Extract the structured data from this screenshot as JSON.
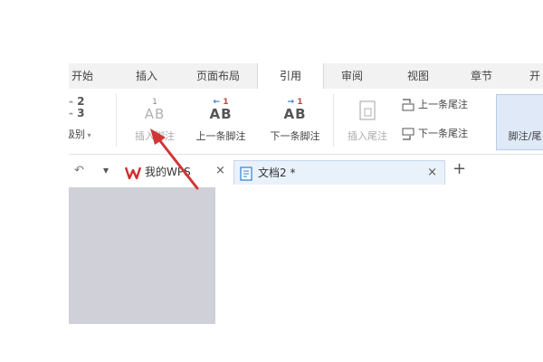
{
  "menu": {
    "tabs": [
      {
        "label": "开始"
      },
      {
        "label": "插入"
      },
      {
        "label": "页面布局"
      },
      {
        "label": "引用"
      },
      {
        "label": "审阅"
      },
      {
        "label": "视图"
      },
      {
        "label": "章节"
      },
      {
        "label": "开"
      }
    ],
    "active_index": 3
  },
  "ribbon": {
    "level_label": "级别",
    "level_numbers": [
      "2",
      "3"
    ],
    "insert_footnote": "插入脚注",
    "prev_footnote": "上一条脚注",
    "next_footnote": "下一条脚注",
    "insert_endnote": "插入尾注",
    "prev_endnote": "上一条尾注",
    "next_endnote": "下一条尾注",
    "footnote_endnote": "脚注/尾",
    "ab_text": "AB",
    "superscript": "1"
  },
  "doc_tabs": {
    "wps_tab": "我的WPS",
    "doc_tab": "文档2 *",
    "close_glyph": "×",
    "add_glyph": "+",
    "dropdown_glyph": "▾",
    "back_glyph": "↶"
  },
  "colors": {
    "arrow": "#d13636",
    "accent_blue": "#2d7bd1",
    "wps_red": "#d42b2b"
  }
}
